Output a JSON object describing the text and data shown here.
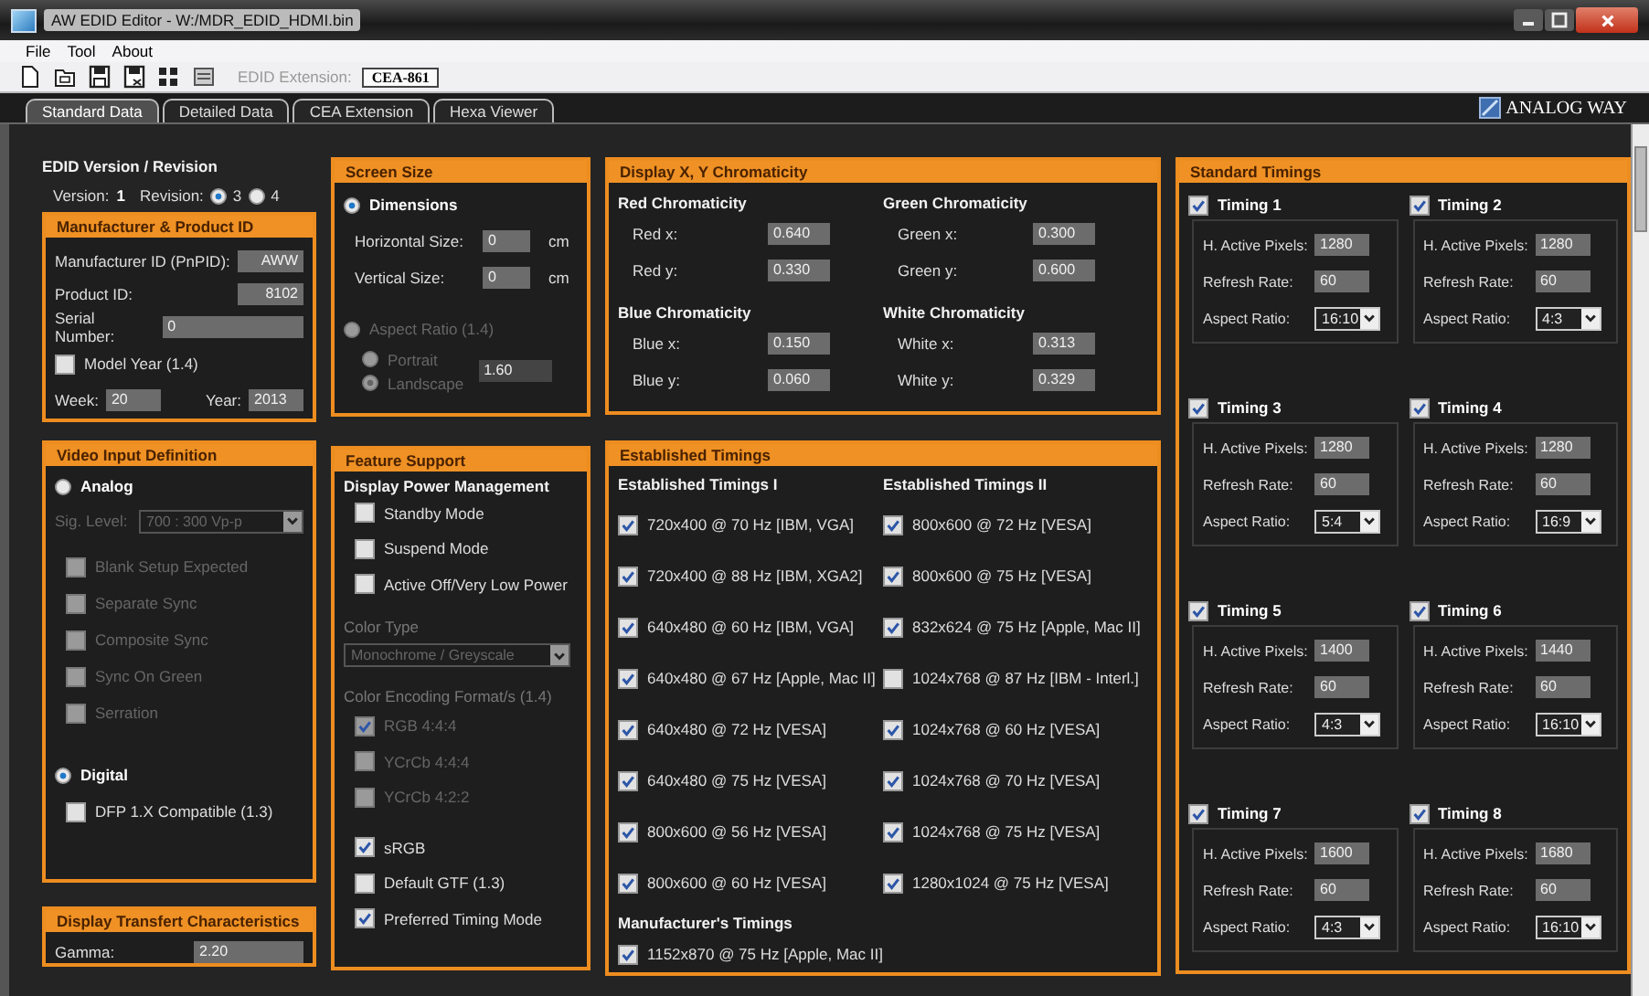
{
  "window": {
    "title": "AW EDID Editor - W:/MDR_EDID_HDMI.bin"
  },
  "menu": [
    "File",
    "Tool",
    "About"
  ],
  "toolbar": {
    "extension_label": "EDID Extension:",
    "extension_value": "CEA-861"
  },
  "tabs": [
    {
      "label": "Standard Data",
      "selected": true
    },
    {
      "label": "Detailed Data",
      "selected": false
    },
    {
      "label": "CEA Extension",
      "selected": false
    },
    {
      "label": "Hexa Viewer",
      "selected": false
    }
  ],
  "logo": "ANALOG WAY",
  "version": {
    "title": "EDID Version / Revision",
    "version_label": "Version:",
    "version": "1",
    "revision_label": "Revision:",
    "revisions": [
      {
        "label": "3",
        "selected": true
      },
      {
        "label": "4",
        "selected": false
      }
    ]
  },
  "manufacturer": {
    "title": "Manufacturer & Product ID",
    "fields": [
      {
        "label": "Manufacturer ID (PnPID):",
        "value": "AWW"
      },
      {
        "label": "Product ID:",
        "value": "8102"
      },
      {
        "label": "Serial Number:",
        "value": "0"
      }
    ],
    "model_year": {
      "label": "Model Year (1.4)",
      "checked": false
    },
    "week_label": "Week:",
    "week": "20",
    "year_label": "Year:",
    "year": "2013"
  },
  "video_input": {
    "title": "Video Input Definition",
    "analog": {
      "label": "Analog",
      "selected": false
    },
    "sig_level_label": "Sig. Level:",
    "sig_level": "700 : 300 Vp-p",
    "analog_options": [
      {
        "label": "Blank Setup Expected",
        "checked": false,
        "disabled": true
      },
      {
        "label": "Separate Sync",
        "checked": false,
        "disabled": true
      },
      {
        "label": "Composite Sync",
        "checked": false,
        "disabled": true
      },
      {
        "label": "Sync On Green",
        "checked": false,
        "disabled": true
      },
      {
        "label": "Serration",
        "checked": false,
        "disabled": true
      }
    ],
    "digital": {
      "label": "Digital",
      "selected": true
    },
    "digital_options": [
      {
        "label": "DFP 1.X Compatible (1.3)",
        "checked": false,
        "disabled": false
      }
    ]
  },
  "transfer": {
    "title": "Display Transfert Characteristics",
    "gamma_label": "Gamma:",
    "gamma": "2.20"
  },
  "screen_size": {
    "title": "Screen Size",
    "dimensions": {
      "label": "Dimensions",
      "selected": true,
      "disabled": false
    },
    "rows": [
      {
        "label": "Horizontal Size:",
        "value": "0",
        "unit": "cm"
      },
      {
        "label": "Vertical Size:",
        "value": "0",
        "unit": "cm"
      }
    ],
    "aspect": {
      "label": "Aspect Ratio (1.4)",
      "selected": false,
      "disabled": true
    },
    "orientations": [
      {
        "label": "Portrait",
        "selected": false,
        "disabled": true
      },
      {
        "label": "Landscape",
        "selected": true,
        "disabled": true
      }
    ],
    "ratio": "1.60"
  },
  "feature": {
    "title": "Feature Support",
    "power_title": "Display Power Management",
    "power": [
      {
        "label": "Standby Mode",
        "checked": false,
        "disabled": false
      },
      {
        "label": "Suspend Mode",
        "checked": false,
        "disabled": false
      },
      {
        "label": "Active Off/Very Low Power",
        "checked": false,
        "disabled": false
      }
    ],
    "color_type": {
      "label": "Color Type",
      "value": "Monochrome / Greyscale",
      "disabled": true
    },
    "encoding": {
      "label": "Color Encoding Format/s (1.4)",
      "disabled": true,
      "options": [
        {
          "label": "RGB 4:4:4",
          "checked": true,
          "disabled": true
        },
        {
          "label": "YCrCb 4:4:4",
          "checked": false,
          "disabled": true
        },
        {
          "label": "YCrCb 4:2:2",
          "checked": false,
          "disabled": true
        }
      ]
    },
    "other": [
      {
        "label": "sRGB",
        "checked": true,
        "disabled": false
      },
      {
        "label": "Default GTF (1.3)",
        "checked": false,
        "disabled": false
      },
      {
        "label": "Preferred Timing Mode",
        "checked": true,
        "disabled": false
      }
    ]
  },
  "chromaticity": {
    "title": "Display X, Y Chromaticity",
    "groups": [
      {
        "title": "Red Chromaticity",
        "fields": [
          {
            "label": "Red x:",
            "value": "0.640"
          },
          {
            "label": "Red y:",
            "value": "0.330"
          }
        ]
      },
      {
        "title": "Green Chromaticity",
        "fields": [
          {
            "label": "Green x:",
            "value": "0.300"
          },
          {
            "label": "Green y:",
            "value": "0.600"
          }
        ]
      },
      {
        "title": "Blue Chromaticity",
        "fields": [
          {
            "label": "Blue x:",
            "value": "0.150"
          },
          {
            "label": "Blue y:",
            "value": "0.060"
          }
        ]
      },
      {
        "title": "White Chromaticity",
        "fields": [
          {
            "label": "White x:",
            "value": "0.313"
          },
          {
            "label": "White y:",
            "value": "0.329"
          }
        ]
      }
    ]
  },
  "established": {
    "title": "Established Timings",
    "columns": [
      {
        "title": "Established Timings I",
        "items": [
          {
            "label": "720x400 @ 70 Hz [IBM, VGA]",
            "checked": true
          },
          {
            "label": "720x400 @ 88 Hz [IBM, XGA2]",
            "checked": true
          },
          {
            "label": "640x480 @ 60 Hz [IBM, VGA]",
            "checked": true
          },
          {
            "label": "640x480 @ 67 Hz [Apple, Mac II]",
            "checked": true
          },
          {
            "label": "640x480 @ 72 Hz [VESA]",
            "checked": true
          },
          {
            "label": "640x480 @ 75 Hz [VESA]",
            "checked": true
          },
          {
            "label": "800x600 @ 56 Hz [VESA]",
            "checked": true
          },
          {
            "label": "800x600 @ 60 Hz [VESA]",
            "checked": true
          }
        ]
      },
      {
        "title": "Established Timings II",
        "items": [
          {
            "label": "800x600 @ 72 Hz [VESA]",
            "checked": true
          },
          {
            "label": "800x600 @ 75 Hz [VESA]",
            "checked": true
          },
          {
            "label": "832x624 @ 75 Hz [Apple, Mac II]",
            "checked": true
          },
          {
            "label": "1024x768 @ 87 Hz [IBM - Interl.]",
            "checked": false
          },
          {
            "label": "1024x768 @ 60 Hz [VESA]",
            "checked": true
          },
          {
            "label": "1024x768 @ 70 Hz [VESA]",
            "checked": true
          },
          {
            "label": "1024x768 @ 75 Hz [VESA]",
            "checked": true
          },
          {
            "label": "1280x1024 @ 75 Hz [VESA]",
            "checked": true
          }
        ]
      }
    ],
    "manufacturer_title": "Manufacturer's Timings",
    "manufacturer_items": [
      {
        "label": "1152x870 @ 75 Hz [Apple, Mac II]",
        "checked": true
      }
    ]
  },
  "standard": {
    "title": "Standard Timings",
    "timings": [
      {
        "label": "Timing 1",
        "checked": true,
        "fields": [
          {
            "kind": "text",
            "label": "H. Active Pixels:",
            "value": "1280"
          },
          {
            "kind": "text",
            "label": "Refresh Rate:",
            "value": "60"
          },
          {
            "kind": "select",
            "label": "Aspect Ratio:",
            "value": "16:10"
          }
        ]
      },
      {
        "label": "Timing 2",
        "checked": true,
        "fields": [
          {
            "kind": "text",
            "label": "H. Active Pixels:",
            "value": "1280"
          },
          {
            "kind": "text",
            "label": "Refresh Rate:",
            "value": "60"
          },
          {
            "kind": "select",
            "label": "Aspect Ratio:",
            "value": "4:3"
          }
        ]
      },
      {
        "label": "Timing 3",
        "checked": true,
        "fields": [
          {
            "kind": "text",
            "label": "H. Active Pixels:",
            "value": "1280"
          },
          {
            "kind": "text",
            "label": "Refresh Rate:",
            "value": "60"
          },
          {
            "kind": "select",
            "label": "Aspect Ratio:",
            "value": "5:4"
          }
        ]
      },
      {
        "label": "Timing 4",
        "checked": true,
        "fields": [
          {
            "kind": "text",
            "label": "H. Active Pixels:",
            "value": "1280"
          },
          {
            "kind": "text",
            "label": "Refresh Rate:",
            "value": "60"
          },
          {
            "kind": "select",
            "label": "Aspect Ratio:",
            "value": "16:9"
          }
        ]
      },
      {
        "label": "Timing 5",
        "checked": true,
        "fields": [
          {
            "kind": "text",
            "label": "H. Active Pixels:",
            "value": "1400"
          },
          {
            "kind": "text",
            "label": "Refresh Rate:",
            "value": "60"
          },
          {
            "kind": "select",
            "label": "Aspect Ratio:",
            "value": "4:3"
          }
        ]
      },
      {
        "label": "Timing 6",
        "checked": true,
        "fields": [
          {
            "kind": "text",
            "label": "H. Active Pixels:",
            "value": "1440"
          },
          {
            "kind": "text",
            "label": "Refresh Rate:",
            "value": "60"
          },
          {
            "kind": "select",
            "label": "Aspect Ratio:",
            "value": "16:10"
          }
        ]
      },
      {
        "label": "Timing 7",
        "checked": true,
        "fields": [
          {
            "kind": "text",
            "label": "H. Active Pixels:",
            "value": "1600"
          },
          {
            "kind": "text",
            "label": "Refresh Rate:",
            "value": "60"
          },
          {
            "kind": "select",
            "label": "Aspect Ratio:",
            "value": "4:3"
          }
        ]
      },
      {
        "label": "Timing 8",
        "checked": true,
        "fields": [
          {
            "kind": "text",
            "label": "H. Active Pixels:",
            "value": "1680"
          },
          {
            "kind": "text",
            "label": "Refresh Rate:",
            "value": "60"
          },
          {
            "kind": "select",
            "label": "Aspect Ratio:",
            "value": "16:10"
          }
        ]
      }
    ]
  }
}
